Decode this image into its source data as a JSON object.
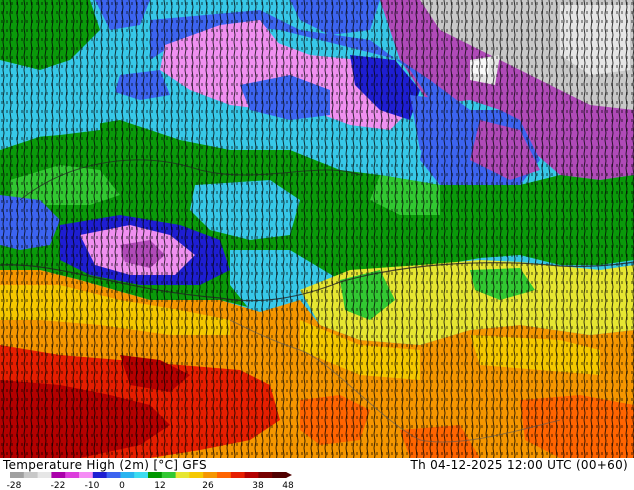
{
  "title": "Temperature High (2m) [°C] GFS",
  "datetime": "Th 04-12-2025 12:00 UTC (00+60)",
  "colorbar": {
    "ticks": [
      "-28",
      "-22",
      "-10",
      "0",
      "12",
      "26",
      "38",
      "48"
    ],
    "colors": [
      "#a0a0a0",
      "#c8c8c8",
      "#e6e6e6",
      "#aa00aa",
      "#dc3cdc",
      "#f58cf5",
      "#1e1ed2",
      "#3c64f0",
      "#28b4f0",
      "#3cdcf0",
      "#009600",
      "#32c832",
      "#e6e632",
      "#f5c800",
      "#f59600",
      "#ff6400",
      "#e61e00",
      "#b40000",
      "#780000",
      "#500000"
    ]
  }
}
